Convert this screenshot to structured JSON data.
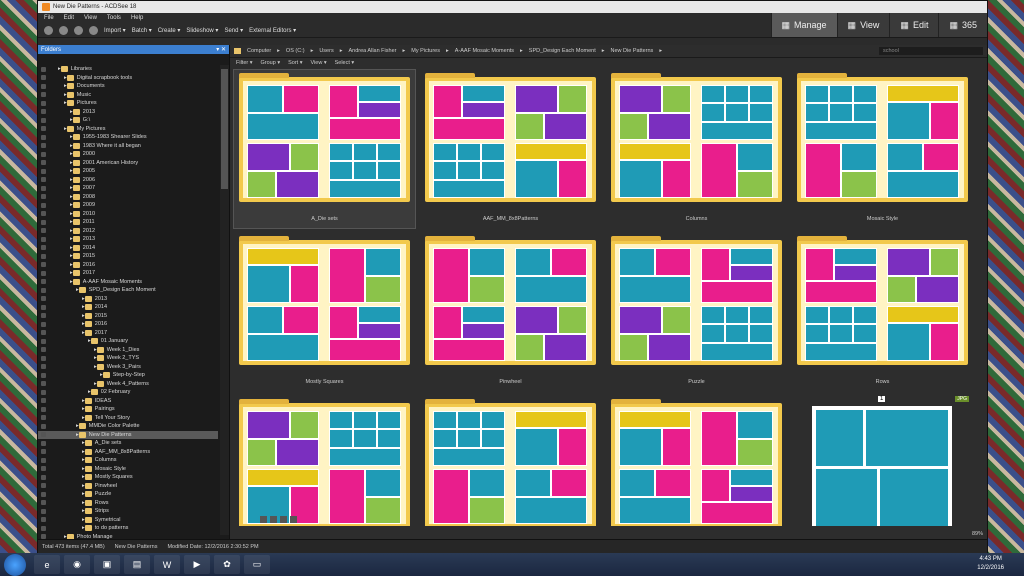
{
  "window": {
    "title": "New Die Patterns - ACDSee 18"
  },
  "menu": [
    "File",
    "Edit",
    "View",
    "Tools",
    "Help"
  ],
  "toolbar": [
    "Import ▾",
    "Batch ▾",
    "Create ▾",
    "Slideshow ▾",
    "Send ▾",
    "External Editors ▾"
  ],
  "modes": [
    {
      "label": "Manage",
      "icon": "grid-icon"
    },
    {
      "label": "View",
      "icon": "eye-icon"
    },
    {
      "label": "Edit",
      "icon": "tools-icon"
    },
    {
      "label": "365",
      "icon": "cloud-icon"
    }
  ],
  "folders_panel": {
    "title": "Folders"
  },
  "tree": [
    {
      "label": "Libraries",
      "indent": 2
    },
    {
      "label": "Digital scrapbook tools",
      "indent": 3
    },
    {
      "label": "Documents",
      "indent": 3
    },
    {
      "label": "Music",
      "indent": 3
    },
    {
      "label": "Pictures",
      "indent": 3
    },
    {
      "label": "2013",
      "indent": 4
    },
    {
      "label": "G:\\",
      "indent": 4
    },
    {
      "label": "My Pictures",
      "indent": 3
    },
    {
      "label": "1955-1983  Shearer Slides",
      "indent": 4
    },
    {
      "label": "1983 Where it all began",
      "indent": 4
    },
    {
      "label": "2000",
      "indent": 4
    },
    {
      "label": "2001 American History",
      "indent": 4
    },
    {
      "label": "2005",
      "indent": 4
    },
    {
      "label": "2006",
      "indent": 4
    },
    {
      "label": "2007",
      "indent": 4
    },
    {
      "label": "2008",
      "indent": 4
    },
    {
      "label": "2009",
      "indent": 4
    },
    {
      "label": "2010",
      "indent": 4
    },
    {
      "label": "2011",
      "indent": 4
    },
    {
      "label": "2012",
      "indent": 4
    },
    {
      "label": "2013",
      "indent": 4
    },
    {
      "label": "2014",
      "indent": 4
    },
    {
      "label": "2015",
      "indent": 4
    },
    {
      "label": "2016",
      "indent": 4
    },
    {
      "label": "2017",
      "indent": 4
    },
    {
      "label": "A-AAF Mosaic Moments",
      "indent": 4
    },
    {
      "label": "SPD_Design Each Moment",
      "indent": 5
    },
    {
      "label": "2013",
      "indent": 6
    },
    {
      "label": "2014",
      "indent": 6
    },
    {
      "label": "2015",
      "indent": 6
    },
    {
      "label": "2016",
      "indent": 6
    },
    {
      "label": "2017",
      "indent": 6
    },
    {
      "label": "01 January",
      "indent": 7
    },
    {
      "label": "Week 1_Dies",
      "indent": 8
    },
    {
      "label": "Week 2_TYS",
      "indent": 8
    },
    {
      "label": "Week 3_Pairs",
      "indent": 8
    },
    {
      "label": "Step-by-Step",
      "indent": 9
    },
    {
      "label": "Week 4_Patterns",
      "indent": 8
    },
    {
      "label": "02 February",
      "indent": 7
    },
    {
      "label": "IDEAS",
      "indent": 6
    },
    {
      "label": "Pairings",
      "indent": 6
    },
    {
      "label": "Tell Your Story",
      "indent": 6
    },
    {
      "label": "MMDie Color Palette",
      "indent": 5
    },
    {
      "label": "New Die Patterns",
      "indent": 5,
      "selected": true
    },
    {
      "label": "A_Die sets",
      "indent": 6
    },
    {
      "label": "AAF_MM_8x8Patterns",
      "indent": 6
    },
    {
      "label": "Columns",
      "indent": 6
    },
    {
      "label": "Mosaic Style",
      "indent": 6
    },
    {
      "label": "Mostly Squares",
      "indent": 6
    },
    {
      "label": "Pinwheel",
      "indent": 6
    },
    {
      "label": "Puzzle",
      "indent": 6
    },
    {
      "label": "Rows",
      "indent": 6
    },
    {
      "label": "Strips",
      "indent": 6
    },
    {
      "label": "Symetrical",
      "indent": 6
    },
    {
      "label": "to do patterns",
      "indent": 6
    },
    {
      "label": "Photo Manage",
      "indent": 3
    }
  ],
  "breadcrumb": [
    "Computer",
    "OS (C:)",
    "Users",
    "Andrea Allan Fisher",
    "My Pictures",
    "A-AAF Mosaic Moments",
    "SPD_Design Each Moment",
    "New Die Patterns"
  ],
  "search": {
    "value": "school"
  },
  "filters": [
    "Filter ▾",
    "Group ▾",
    "Sort ▾",
    "View ▾",
    "Select ▾"
  ],
  "folders": [
    {
      "name": "A_Die sets",
      "selected": true
    },
    {
      "name": "AAF_MM_8x8Patterns"
    },
    {
      "name": "Columns"
    },
    {
      "name": "Mosaic Style"
    },
    {
      "name": "Mostly Squares"
    },
    {
      "name": "Pinwheel"
    },
    {
      "name": "Puzzle"
    },
    {
      "name": "Rows"
    },
    {
      "name": ""
    },
    {
      "name": ""
    },
    {
      "name": ""
    }
  ],
  "last_item": {
    "badge": "1",
    "type": "JPG"
  },
  "colors": {
    "magenta": "#e91e8c",
    "teal": "#1f9bb6",
    "purple": "#7b2fbf",
    "green": "#8bc34a",
    "yellow": "#e6c619",
    "orange": "#e8772e",
    "brown": "#7b5a3a"
  },
  "status": {
    "total": "Total 473 items  (47.4 MB)",
    "folder": "New Die Patterns",
    "modified": "Modified Date: 12/2/2016 2:30:52 PM",
    "zoom": "89%"
  },
  "clock": {
    "time": "4:43 PM",
    "date": "12/2/2016"
  }
}
